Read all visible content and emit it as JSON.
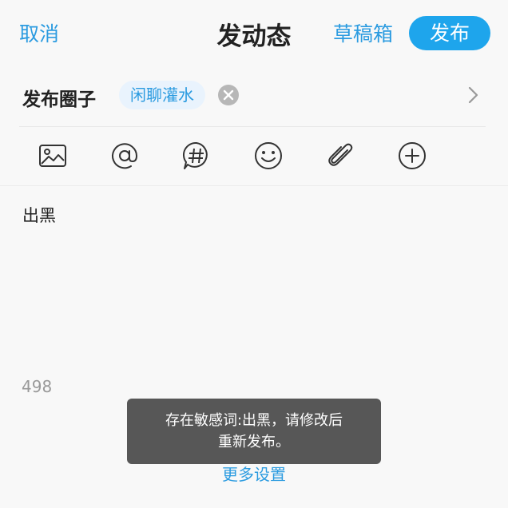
{
  "header": {
    "cancel_label": "取消",
    "title": "发动态",
    "drafts_label": "草稿箱",
    "publish_label": "发布"
  },
  "circle": {
    "label": "发布圈子",
    "selected_tag": "闲聊灌水"
  },
  "toolbar": {
    "icons": [
      "image-icon",
      "at-icon",
      "hashtag-icon",
      "emoji-icon",
      "attachment-icon",
      "add-icon"
    ]
  },
  "editor": {
    "content": "出黑",
    "remaining_chars": "498"
  },
  "footer": {
    "more_settings_label": "更多设置"
  },
  "toast": {
    "line1": "存在敏感词:出黑，请修改后",
    "line2": "重新发布。"
  },
  "colors": {
    "accent": "#2b9be0",
    "publish_bg": "#1ea5ec",
    "toast_bg": "#575757",
    "tag_bg": "#e9f3fd"
  }
}
